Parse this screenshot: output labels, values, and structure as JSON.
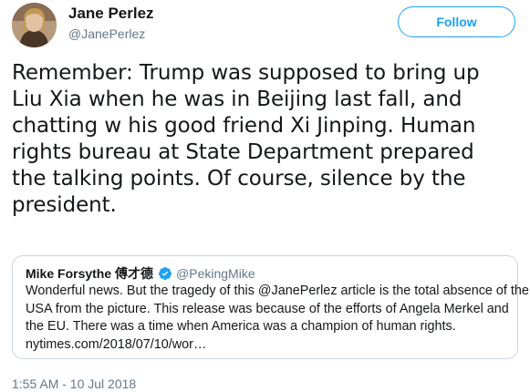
{
  "author": {
    "name": "Jane Perlez",
    "handle": "@JanePerlez",
    "avatar_icon": "profile-photo"
  },
  "follow_button": {
    "label": "Follow",
    "color": "#1da1f2"
  },
  "tweet": {
    "text_lines": [
      "Remember: Trump was supposed to bring up",
      "Liu Xia when he was in Beijing last fall, and",
      "chatting w his good friend Xi Jinping.  Human",
      "rights bureau at State Department prepared",
      "the talking points. Of course, silence by the",
      "president."
    ],
    "timestamp": "1:55 AM - 10 Jul 2018"
  },
  "quoted_tweet": {
    "author_name": "Mike Forsythe 傅才德",
    "verified_icon": "verified-badge",
    "verified_color": "#1da1f2",
    "handle": "@PekingMike",
    "text_lines": [
      "Wonderful news. But the tragedy of this @JanePerlez article is the total absence of the",
      "USA from the picture. This release was because of the efforts of Angela Merkel and",
      "the EU. There was a time when America was a champion of human rights.",
      "nytimes.com/2018/07/10/wor…"
    ]
  }
}
